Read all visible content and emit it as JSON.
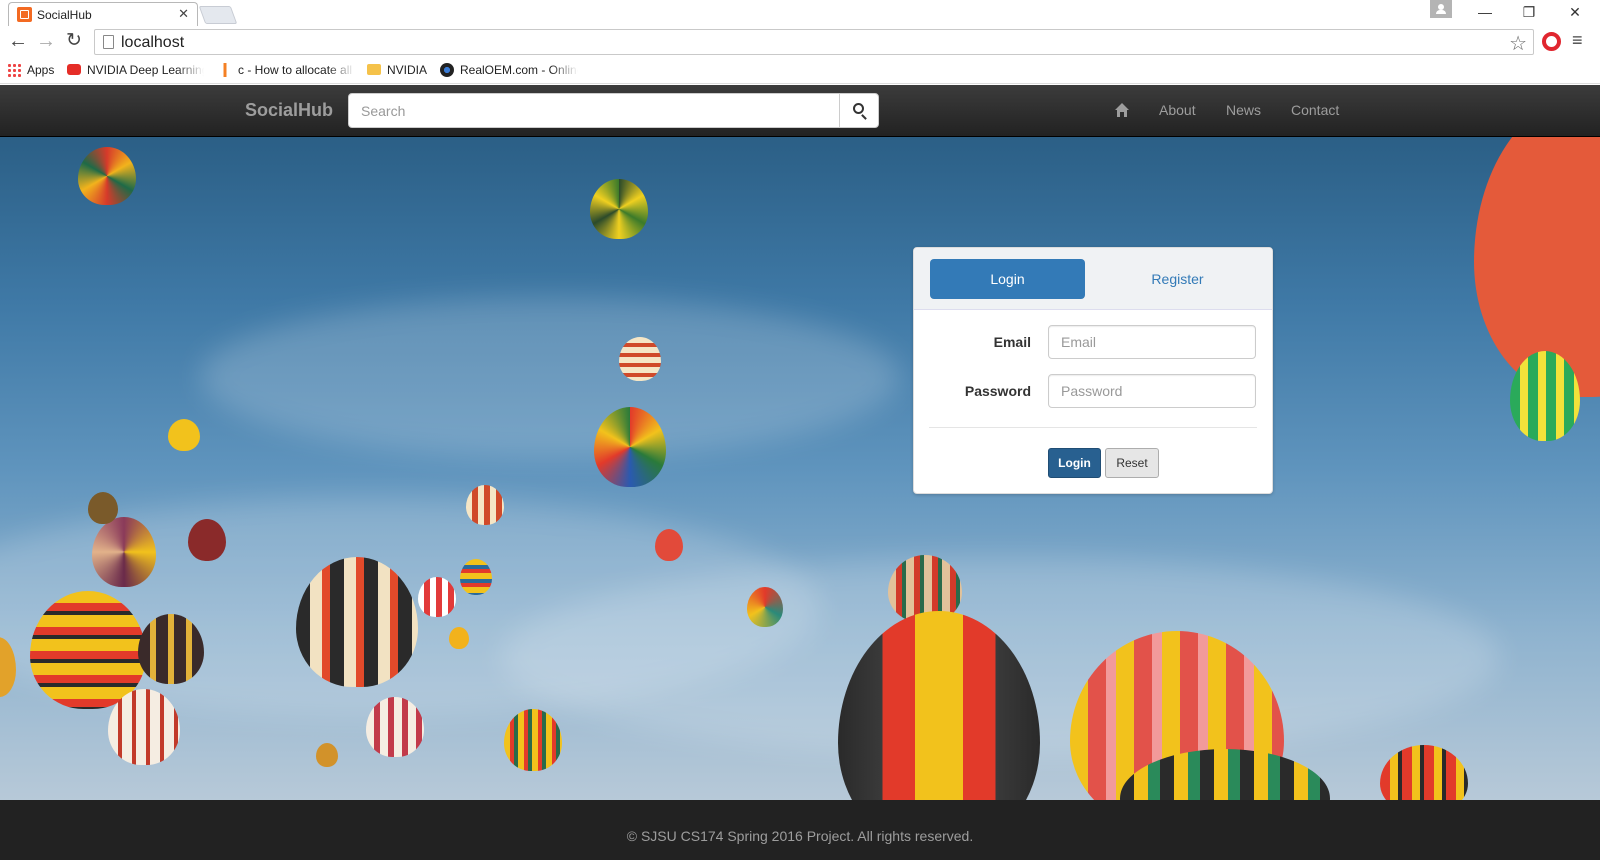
{
  "browser": {
    "tab_title": "SocialHub",
    "tab_close": "✕",
    "url": "localhost",
    "bookmarks": [
      {
        "label": "Apps",
        "icon": "apps-grid-icon"
      },
      {
        "label": "NVIDIA Deep Learning",
        "icon": "youtube-icon"
      },
      {
        "label": "c - How to allocate all",
        "icon": "stackoverflow-icon"
      },
      {
        "label": "NVIDIA",
        "icon": "folder-icon"
      },
      {
        "label": "RealOEM.com - Online",
        "icon": "bmw-icon"
      }
    ],
    "window_controls": {
      "minimize": "—",
      "maximize": "❐",
      "close": "✕"
    }
  },
  "navbar": {
    "brand": "SocialHub",
    "search_placeholder": "Search",
    "links": [
      "About",
      "News",
      "Contact"
    ]
  },
  "login_panel": {
    "tabs": [
      "Login",
      "Register"
    ],
    "email_label": "Email",
    "email_placeholder": "Email",
    "password_label": "Password",
    "password_placeholder": "Password",
    "login_button": "Login",
    "reset_button": "Reset"
  },
  "footer": {
    "text": "© SJSU CS174 Spring 2016 Project. All rights reserved."
  },
  "colors": {
    "navbar_bg": "#222222",
    "primary": "#337ab7",
    "footer_bg": "#222222"
  }
}
